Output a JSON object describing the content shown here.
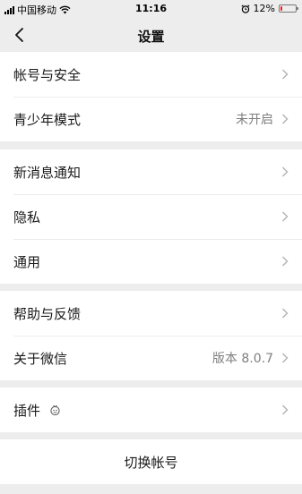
{
  "status_bar": {
    "carrier": "中国移动",
    "time": "11:16",
    "battery": "12%",
    "battery_level": 0.12,
    "battery_color": "#e02020"
  },
  "nav": {
    "title": "设置",
    "back_icon": "chevron-left-icon"
  },
  "groups": [
    {
      "items": [
        {
          "label": "帐号与安全",
          "value": ""
        },
        {
          "label": "青少年模式",
          "value": "未开启"
        }
      ]
    },
    {
      "items": [
        {
          "label": "新消息通知",
          "value": ""
        },
        {
          "label": "隐私",
          "value": ""
        },
        {
          "label": "通用",
          "value": ""
        }
      ]
    },
    {
      "items": [
        {
          "label": "帮助与反馈",
          "value": ""
        },
        {
          "label": "关于微信",
          "value": "版本 8.0.7"
        }
      ]
    },
    {
      "items": [
        {
          "label": "插件",
          "value": "",
          "icon": "plugin-icon"
        }
      ]
    }
  ],
  "switch_account": {
    "label": "切换帐号"
  },
  "colors": {
    "background": "#ededed",
    "cell": "#ffffff",
    "secondary_text": "#7f7f7f"
  }
}
